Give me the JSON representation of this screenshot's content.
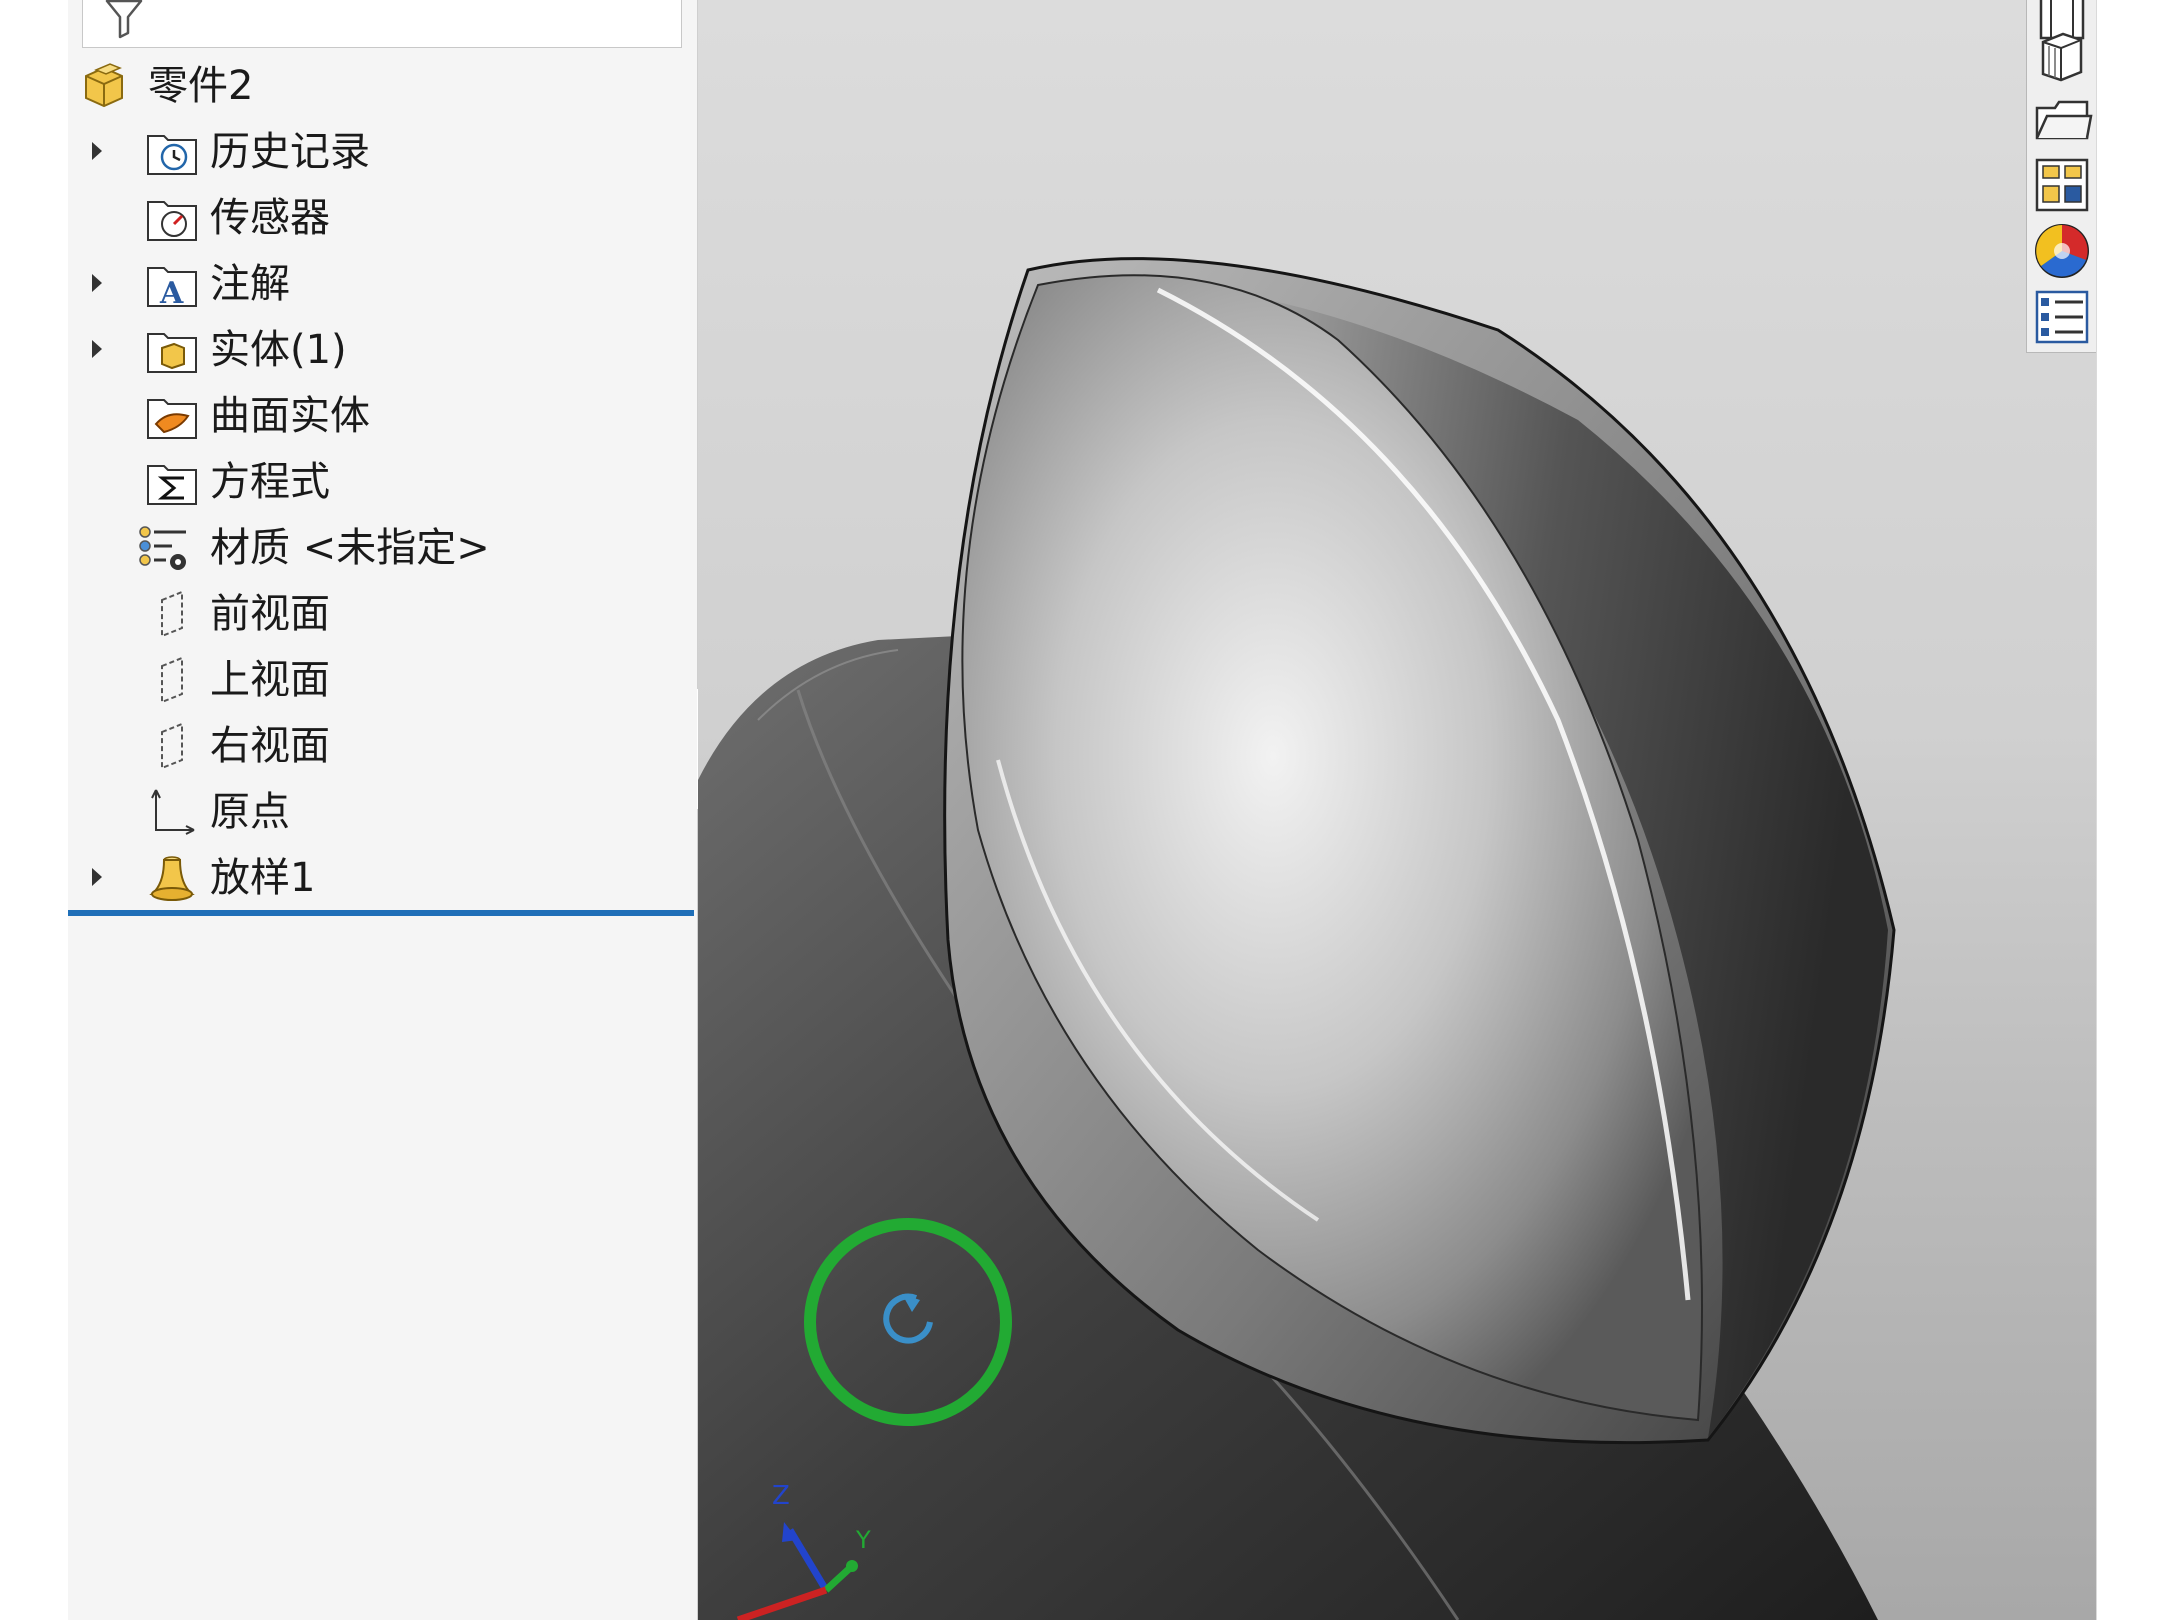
{
  "feature_tree": {
    "root": {
      "label": "零件2",
      "icon": "part-icon"
    },
    "items": [
      {
        "label": "历史记录",
        "icon": "history-folder-icon",
        "expandable": true
      },
      {
        "label": "传感器",
        "icon": "sensors-folder-icon",
        "expandable": false
      },
      {
        "label": "注解",
        "icon": "annotations-folder-icon",
        "expandable": true
      },
      {
        "label": "实体(1)",
        "icon": "solid-bodies-folder-icon",
        "expandable": true
      },
      {
        "label": "曲面实体",
        "icon": "surface-bodies-folder-icon",
        "expandable": false
      },
      {
        "label": "方程式",
        "icon": "equations-folder-icon",
        "expandable": false
      },
      {
        "label": "材质 <未指定>",
        "icon": "material-icon",
        "expandable": false
      },
      {
        "label": "前视面",
        "icon": "plane-icon",
        "expandable": false
      },
      {
        "label": "上视面",
        "icon": "plane-icon",
        "expandable": false
      },
      {
        "label": "右视面",
        "icon": "plane-icon",
        "expandable": false
      },
      {
        "label": "原点",
        "icon": "origin-icon",
        "expandable": false
      },
      {
        "label": "放样1",
        "icon": "loft-feature-icon",
        "expandable": true
      }
    ]
  },
  "task_pane": {
    "buttons": [
      "resources-icon",
      "design-library-icon",
      "file-explorer-icon",
      "view-palette-icon",
      "appearances-icon",
      "custom-properties-icon"
    ]
  },
  "viewport": {
    "triad_axes": [
      "Z",
      "Y"
    ],
    "rotate_cursor": "rotate-view-icon",
    "colors": {
      "highlight": "#22aa33",
      "tree_end_line": "#1f6fb8"
    }
  }
}
